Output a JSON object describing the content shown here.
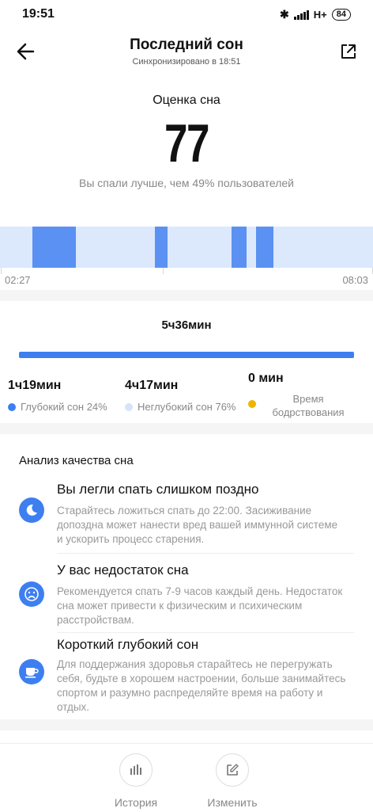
{
  "status": {
    "time": "19:51",
    "network": "H+",
    "battery": "84"
  },
  "header": {
    "title": "Последний сон",
    "subtitle": "Синхронизировано в 18:51"
  },
  "score": {
    "label": "Оценка сна",
    "value": "77",
    "compare": "Вы спали лучше, чем 49% пользователей"
  },
  "timeline": {
    "start": "02:27",
    "end": "08:03"
  },
  "summary": {
    "total": "5ч36мин",
    "deep": {
      "value": "1ч19мин",
      "label": "Глубокий сон 24%",
      "color": "#3d7ff0"
    },
    "light": {
      "value": "4ч17мин",
      "label": "Неглубокий сон 76%",
      "color": "#d6e3fa"
    },
    "awake": {
      "value": "0 мин",
      "label": "Время бодрствования",
      "color": "#f0b400"
    }
  },
  "analysis": {
    "title": "Анализ качества сна",
    "items": [
      {
        "icon": "moon-icon",
        "title": "Вы легли спать слишком поздно",
        "text": "Старайтесь ложиться спать до 22:00. Засиживание допоздна может нанести вред вашей иммунной системе и ускорить процесс старения."
      },
      {
        "icon": "sad-face-icon",
        "title": "У вас недостаток сна",
        "text": "Рекомендуется спать 7-9 часов каждый день. Недостаток сна может привести к физическим и психическим расстройствам."
      },
      {
        "icon": "cup-icon",
        "title": "Короткий глубокий сон",
        "text": "Для поддержания здоровья старайтесь не перегружать себя, будьте в хорошем настроении, больше занимайтесь спортом и разумно распределяйте время на работу и отдых."
      }
    ]
  },
  "bottom": {
    "history": "История",
    "edit": "Изменить"
  }
}
